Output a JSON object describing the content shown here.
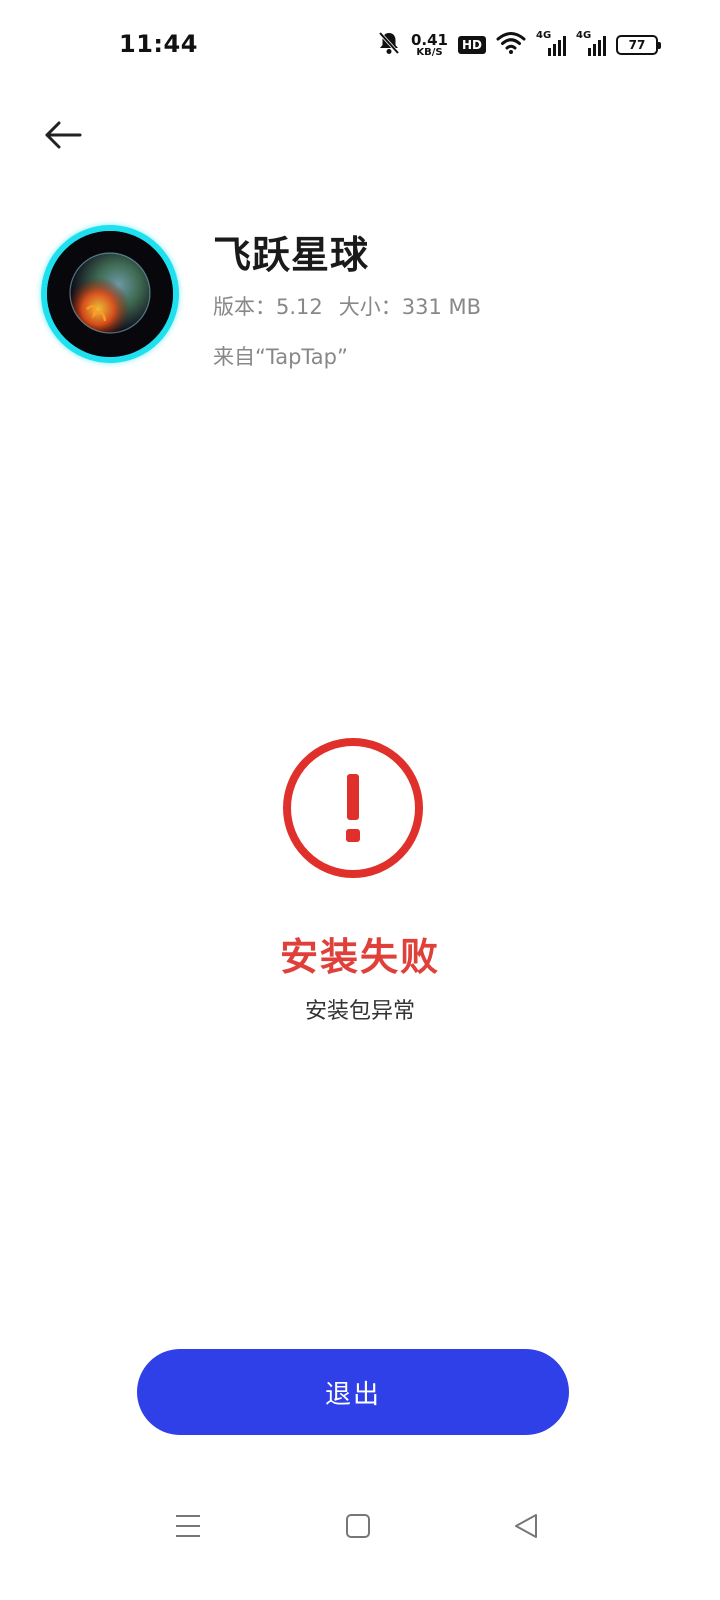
{
  "status_bar": {
    "time": "11:44",
    "net_speed_value": "0.41",
    "net_speed_unit": "KB/S",
    "hd_label": "HD",
    "signal1_label": "4G",
    "signal2_label": "4G",
    "battery": "77"
  },
  "app": {
    "name": "飞跃星球",
    "version": "版本：5.12",
    "size": "大小：331 MB",
    "source": "来自“TapTap”",
    "accent_color": "#1fe0ee"
  },
  "result": {
    "title": "安装失败",
    "description": "安装包异常",
    "error_color": "#e0403a"
  },
  "actions": {
    "exit_label": "退出",
    "button_color": "#3040e8"
  },
  "nav": {
    "icons": [
      "menu-icon",
      "home-icon",
      "back-triangle-icon"
    ]
  }
}
